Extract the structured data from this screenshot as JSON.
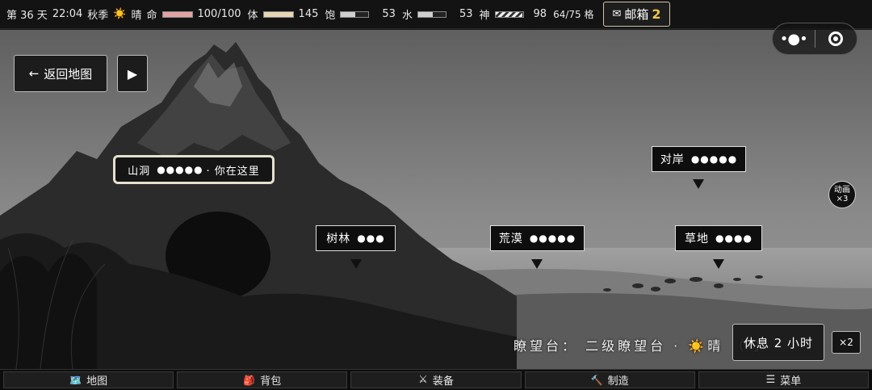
{
  "status": {
    "day": "第 36 天",
    "time": "22:04",
    "season": "秋季",
    "weather_icon": "☀️",
    "weather": "晴",
    "hp_label": "命",
    "hp_value": "100/100",
    "hp_fraction": 1.0,
    "hp_color": "#e2a3a3",
    "stamina_label": "体",
    "stamina_value": "145",
    "stamina_fraction": 1.0,
    "stamina_color": "#e6d6b4",
    "hunger_label": "饱",
    "hunger_value": "53",
    "hunger_fraction": 0.53,
    "water_label": "水",
    "water_value": "53",
    "water_fraction": 0.53,
    "spirit_label": "神",
    "spirit_value": "98",
    "spirit_fraction": 0.98,
    "capacity": "64/75 格",
    "mail_icon": "✉",
    "mail_label": "邮箱",
    "mail_count": "2"
  },
  "capsule": {
    "more_icon": "•●•",
    "close_icon": "target-icon"
  },
  "controls": {
    "back_arrow": "←",
    "back_label": "返回地图",
    "play_icon": "▶",
    "anim_line1": "动画",
    "anim_line2": "×3",
    "rest_label": "休息 2 小时",
    "speed_label": "×2"
  },
  "locations": {
    "cave": {
      "name": "山洞",
      "dots": "●●●●●",
      "here": "· 你在这里"
    },
    "forest": {
      "name": "树林",
      "dots": "●●●"
    },
    "desert": {
      "name": "荒漠",
      "dots": "●●●●●"
    },
    "grass": {
      "name": "草地",
      "dots": "●●●●"
    },
    "shore": {
      "name": "对岸",
      "dots": "●●●●●"
    }
  },
  "lookout_text": "瞭望台： 二级瞭望台 · ☀️晴 （可",
  "nav": [
    {
      "icon": "🗺️",
      "label": "地图"
    },
    {
      "icon": "🎒",
      "label": "背包"
    },
    {
      "icon": "⚔",
      "label": "装备"
    },
    {
      "icon": "🔨",
      "label": "制造"
    },
    {
      "icon": "☰",
      "label": "菜单"
    }
  ]
}
